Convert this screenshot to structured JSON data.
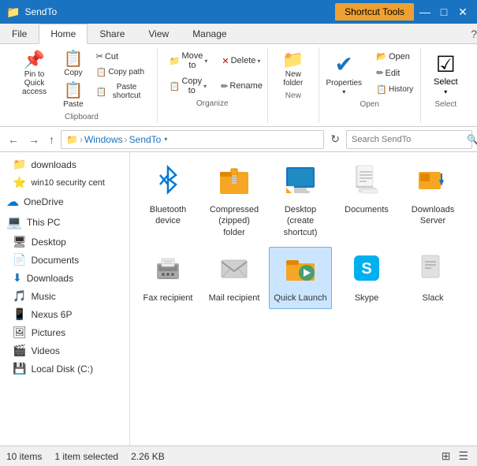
{
  "titleBar": {
    "icon": "📁",
    "title": "SendTo",
    "activeTab": "Shortcut Tools",
    "controls": [
      "—",
      "□",
      "✕"
    ]
  },
  "ribbon": {
    "tabs": [
      "File",
      "Home",
      "Share",
      "View",
      "Manage"
    ],
    "activeTab": "Home",
    "groups": {
      "clipboard": {
        "label": "Clipboard",
        "buttons": [
          {
            "label": "Pin to Quick\naccess",
            "icon": "📌"
          },
          {
            "label": "Copy",
            "icon": "📋"
          },
          {
            "label": "Paste",
            "icon": "📋"
          },
          {
            "label": "Cut",
            "icon": "✂️"
          }
        ]
      },
      "organize": {
        "label": "Organize",
        "buttons": [
          {
            "label": "Move to",
            "icon": "📁",
            "dropdown": true
          },
          {
            "label": "Delete",
            "icon": "🗑",
            "dropdown": true
          },
          {
            "label": "Copy to",
            "icon": "📋",
            "dropdown": true
          },
          {
            "label": "Rename",
            "icon": "✏️"
          }
        ]
      },
      "new": {
        "label": "New",
        "buttons": [
          {
            "label": "New\nfolder",
            "icon": "📁"
          }
        ]
      },
      "open": {
        "label": "Open",
        "buttons": [
          {
            "label": "Properties",
            "icon": "ℹ️",
            "dropdown": true
          }
        ]
      },
      "select": {
        "label": "Select",
        "buttons": [
          {
            "label": "Select",
            "icon": "☑️",
            "dropdown": true
          }
        ]
      }
    }
  },
  "addressBar": {
    "back": "←",
    "forward": "→",
    "up": "↑",
    "breadcrumb": [
      "Windows",
      "SendTo"
    ],
    "refresh": "↻",
    "searchPlaceholder": "Search SendTo"
  },
  "sidebar": {
    "items": [
      {
        "label": "downloads",
        "icon": "📁",
        "type": "folder"
      },
      {
        "label": "win10 security cent",
        "icon": "⭐",
        "type": "folder"
      },
      {
        "label": "OneDrive",
        "icon": "☁️",
        "type": "cloud"
      },
      {
        "label": "This PC",
        "icon": "💻",
        "type": "section"
      },
      {
        "label": "Desktop",
        "icon": "🖥",
        "type": "item"
      },
      {
        "label": "Documents",
        "icon": "📄",
        "type": "item"
      },
      {
        "label": "Downloads",
        "icon": "⬇",
        "type": "item"
      },
      {
        "label": "Music",
        "icon": "🎵",
        "type": "item"
      },
      {
        "label": "Nexus 6P",
        "icon": "📱",
        "type": "item"
      },
      {
        "label": "Pictures",
        "icon": "🖼",
        "type": "item"
      },
      {
        "label": "Videos",
        "icon": "🎬",
        "type": "item"
      },
      {
        "label": "Local Disk (C:)",
        "icon": "💾",
        "type": "item"
      }
    ]
  },
  "fileGrid": {
    "items": [
      {
        "label": "Bluetooth device",
        "icon": "bluetooth",
        "selected": false
      },
      {
        "label": "Compressed (zipped) folder",
        "icon": "zip",
        "selected": false
      },
      {
        "label": "Desktop (create shortcut)",
        "icon": "desktop",
        "selected": false
      },
      {
        "label": "Documents",
        "icon": "docs",
        "selected": false
      },
      {
        "label": "Downloads Server",
        "icon": "dlserver",
        "selected": false
      },
      {
        "label": "Fax recipient",
        "icon": "fax",
        "selected": false
      },
      {
        "label": "Mail recipient",
        "icon": "mail",
        "selected": false
      },
      {
        "label": "Quick Launch",
        "icon": "quick",
        "selected": true
      },
      {
        "label": "Skype",
        "icon": "skype",
        "selected": false
      },
      {
        "label": "Slack",
        "icon": "slack",
        "selected": false
      }
    ]
  },
  "statusBar": {
    "itemCount": "10 items",
    "selection": "1 item selected",
    "size": "2.26 KB"
  }
}
